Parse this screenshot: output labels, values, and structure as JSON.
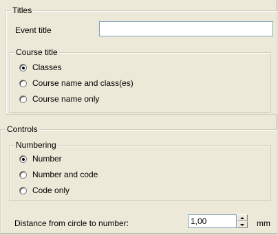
{
  "titles": {
    "legend": "Titles",
    "event_title_label": "Event title",
    "event_title_value": "",
    "course_title": {
      "legend": "Course title",
      "options": [
        {
          "label": "Classes",
          "checked": true
        },
        {
          "label": "Course name and class(es)",
          "checked": false
        },
        {
          "label": "Course name only",
          "checked": false
        }
      ]
    }
  },
  "controls": {
    "legend": "Controls",
    "numbering": {
      "legend": "Numbering",
      "options": [
        {
          "label": "Number",
          "checked": true
        },
        {
          "label": "Number and code",
          "checked": false
        },
        {
          "label": "Code only",
          "checked": false
        }
      ]
    },
    "distance_label": "Distance from circle to number:",
    "distance_value": "1,00",
    "distance_unit": "mm"
  }
}
